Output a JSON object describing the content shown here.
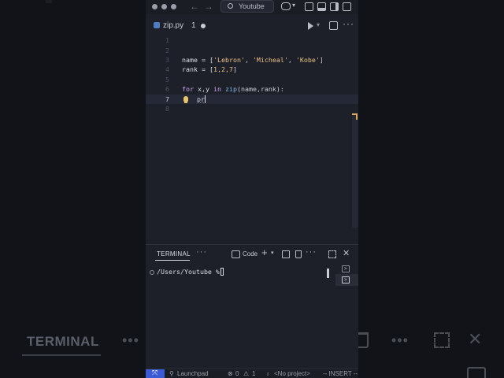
{
  "titlebar": {
    "search_label": "Youtube"
  },
  "tab": {
    "filename": "zip.py",
    "problem_count": "1"
  },
  "editor": {
    "line_numbers": [
      "1",
      "2",
      "3",
      "4",
      "5",
      "6",
      "7",
      "8"
    ],
    "active_line": "7",
    "line3_a": "name = [",
    "line3_s1": "'Lebron'",
    "line3_sep1": ", ",
    "line3_s2": "'Micheal'",
    "line3_sep2": ", ",
    "line3_s3": "'Kobe'",
    "line3_end": "]",
    "line4_a": "rank = [",
    "line4_nums": "1,2,7",
    "line4_end": "]",
    "line6_kw1": "for",
    "line6_vars": " x,y ",
    "line6_kw2": "in",
    "line6_fn": " zip",
    "line6_args": "(name,rank):",
    "line7_typed": "pr"
  },
  "panel": {
    "tab_label": "TERMINAL",
    "shell_label": "Code",
    "prompt": "/Users/Youtube %"
  },
  "statusbar": {
    "launchpad": "Launchpad",
    "errors": "0",
    "warnings": "1",
    "project": "<No project>",
    "mode": "-- INSERT --"
  },
  "background": {
    "terminal_label": "TERMINAL"
  },
  "colors": {
    "editor_bg": "#1e2029",
    "string": "#e8c088",
    "keyword": "#c9a3f0",
    "function": "#7fb6e8",
    "remote_indicator": "#3b5bd6"
  }
}
